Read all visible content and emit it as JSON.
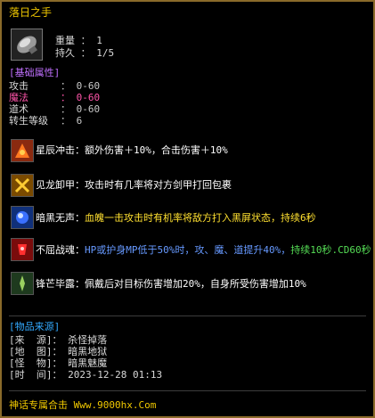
{
  "tooltip": {
    "title": "落日之手",
    "weight_label": "重量 ： 1",
    "durability_label": "持久 ： 1/5",
    "base_section": "[基础属性]",
    "stats": [
      {
        "label": "攻击",
        "value": "： 0-60"
      },
      {
        "label": "魔法",
        "value": "： 0-60"
      },
      {
        "label": "道术",
        "value": "： 0-60"
      },
      {
        "label": "转生等级",
        "value": "： 6"
      }
    ],
    "skills": [
      {
        "name": "星辰冲击：",
        "desc": "额外伤害＋10%，合击伤害＋10%"
      },
      {
        "name": "见龙卸甲：",
        "desc": "攻击时有几率将对方剑甲打回包裹"
      },
      {
        "name": "暗黑无声：",
        "desc": "血魄一击攻击时有机率将敌方打入黑屏状态，持续6秒"
      },
      {
        "name": "不屈战魂：",
        "desc_a": "HP或护身MP低于50%时，攻、魔、道提升40%，",
        "desc_b": "持续10秒.",
        "desc_c": "CD60秒"
      },
      {
        "name": "锋芒毕露：",
        "desc": "佩戴后对目标伤害增加20%，自身所受伤害增加10%"
      }
    ],
    "source_section": "[物品来源]",
    "source": [
      {
        "label": "[来  源]",
        "value": "： 杀怪掉落"
      },
      {
        "label": "[地  图]",
        "value": "： 暗黑地狱"
      },
      {
        "label": "[怪  物]",
        "value": "： 暗黑魅魔"
      },
      {
        "label": "[时  间]",
        "value": "： 2023-12-28 01:13"
      }
    ],
    "footer_prefix": "神话专属合击",
    "footer_url": "Www.9000hx.Com"
  }
}
